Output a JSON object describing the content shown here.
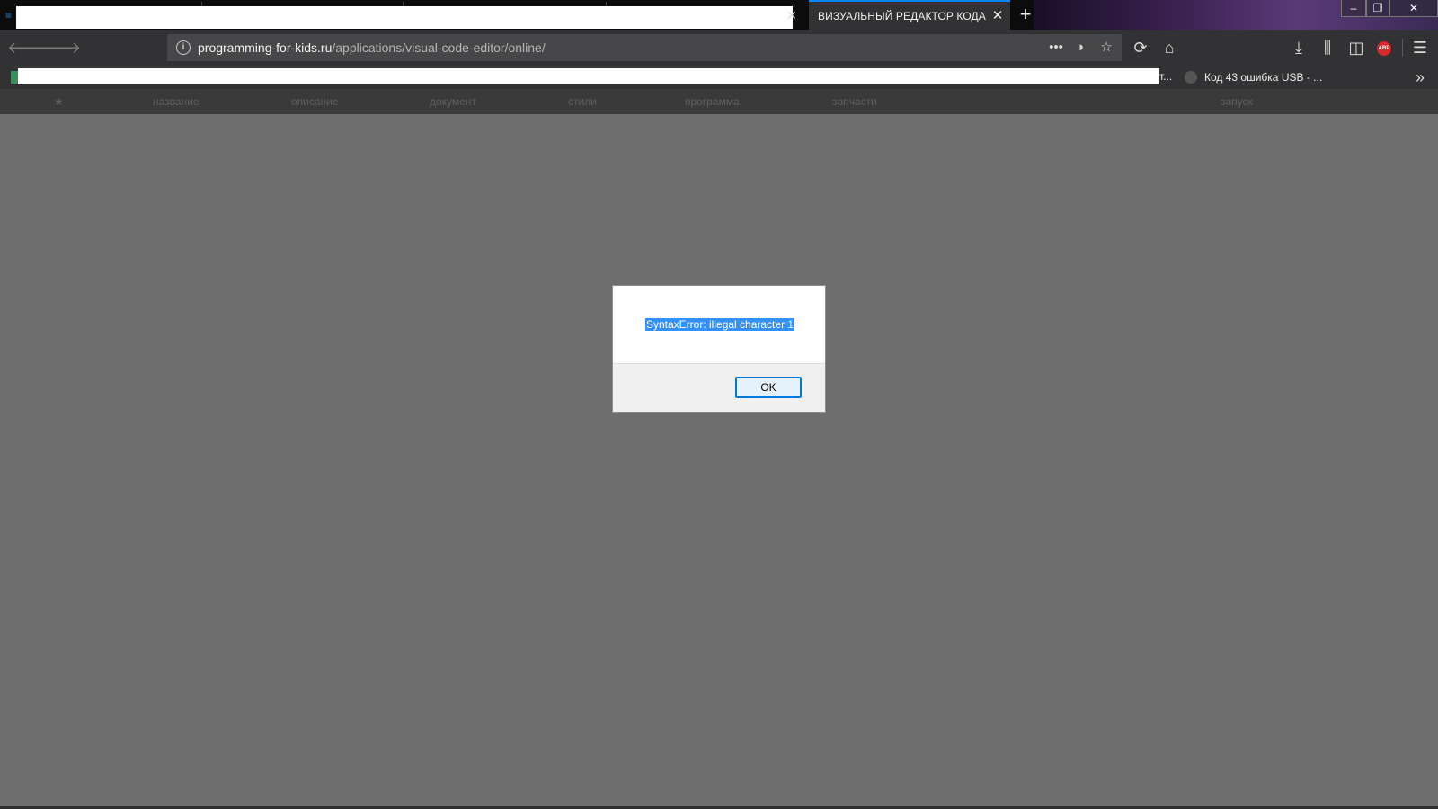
{
  "browser": {
    "active_tab_title": "ВИЗУАЛЬНЫЙ РЕДАКТОР КОДА",
    "close_glyph": "✕",
    "new_tab_glyph": "+",
    "window_controls": {
      "minimize": "–",
      "maximize": "❐",
      "close": "✕"
    },
    "url_host": "programming-for-kids.ru",
    "url_path": "/applications/visual-code-editor/online/",
    "icons": {
      "back": "🡐",
      "forward": "🡒",
      "info": "i",
      "page_actions": "•••",
      "pocket": "◗",
      "bookmark_star": "☆",
      "reload": "⟳",
      "home": "⌂",
      "downloads": "⤓",
      "library": "⫼",
      "sidebar": "◫",
      "abp": "ABP",
      "menu": "☰",
      "bookmarks_overflow": "»"
    }
  },
  "bookmarks_bar": {
    "partial_label": "т...",
    "usb_bookmark": "Код 43 ошибка USB - ..."
  },
  "app_nav": {
    "star": "★",
    "items": [
      "название",
      "описание",
      "документ",
      "стили",
      "программа",
      "запчасти",
      "запуск"
    ]
  },
  "dialog": {
    "message": "SyntaxError: illegal character 1",
    "ok_label": "OK"
  },
  "colors": {
    "background": "#6e6e6e",
    "chrome": "#323234",
    "accent": "#0a84ff",
    "selection": "#3390ff"
  }
}
